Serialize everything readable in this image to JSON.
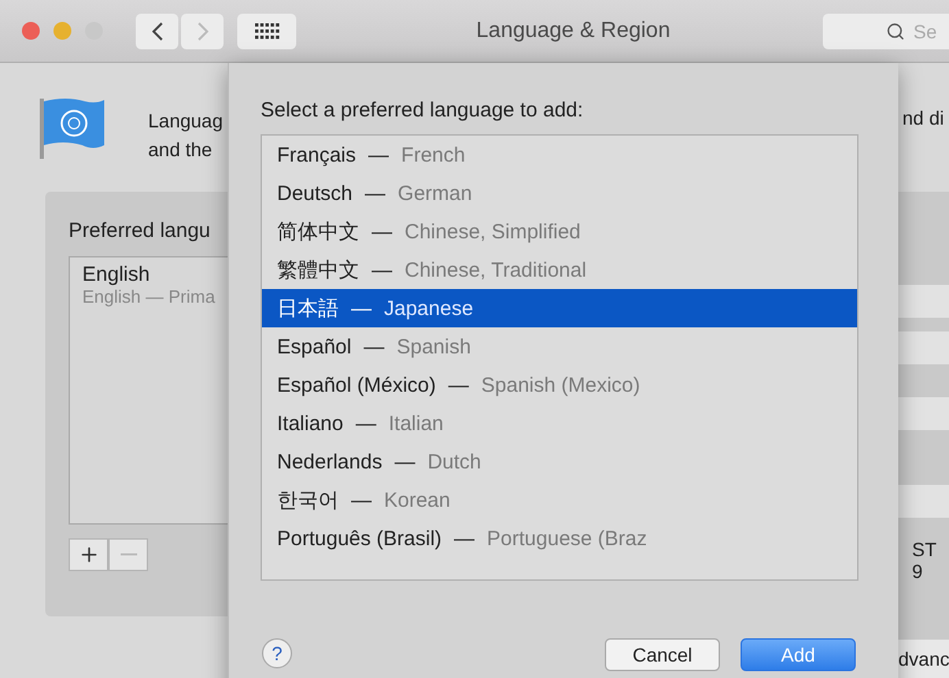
{
  "window": {
    "title": "Language & Region",
    "search_placeholder": "Se"
  },
  "background": {
    "description_lines": [
      "Languag",
      "and the"
    ],
    "description_right": "nd di",
    "preferred_label": "Preferred langu",
    "languages": [
      {
        "name": "English",
        "detail": "English — Prima"
      }
    ],
    "remove_disabled": true,
    "right_texts": [
      "ST",
      "9"
    ],
    "advanced_label": "dvanc"
  },
  "sheet": {
    "title": "Select a preferred language to add:",
    "items": [
      {
        "native": "Français",
        "separator": "—",
        "english": "French",
        "selected": false
      },
      {
        "native": "Deutsch",
        "separator": "—",
        "english": "German",
        "selected": false
      },
      {
        "native": "简体中文",
        "separator": "—",
        "english": "Chinese, Simplified",
        "selected": false
      },
      {
        "native": "繁體中文",
        "separator": "—",
        "english": "Chinese, Traditional",
        "selected": false
      },
      {
        "native": "日本語",
        "separator": "—",
        "english": "Japanese",
        "selected": true
      },
      {
        "native": "Español",
        "separator": "—",
        "english": "Spanish",
        "selected": false
      },
      {
        "native": "Español (México)",
        "separator": "—",
        "english": "Spanish (Mexico)",
        "selected": false
      },
      {
        "native": "Italiano",
        "separator": "—",
        "english": "Italian",
        "selected": false
      },
      {
        "native": "Nederlands",
        "separator": "—",
        "english": "Dutch",
        "selected": false
      },
      {
        "native": "한국어",
        "separator": "—",
        "english": "Korean",
        "selected": false
      },
      {
        "native": "Português (Brasil)",
        "separator": "—",
        "english": "Portuguese (Braz",
        "selected": false
      }
    ],
    "help": "?",
    "buttons": [
      {
        "label": "Cancel",
        "kind": "normal"
      },
      {
        "label": "Add",
        "kind": "default"
      }
    ]
  }
}
